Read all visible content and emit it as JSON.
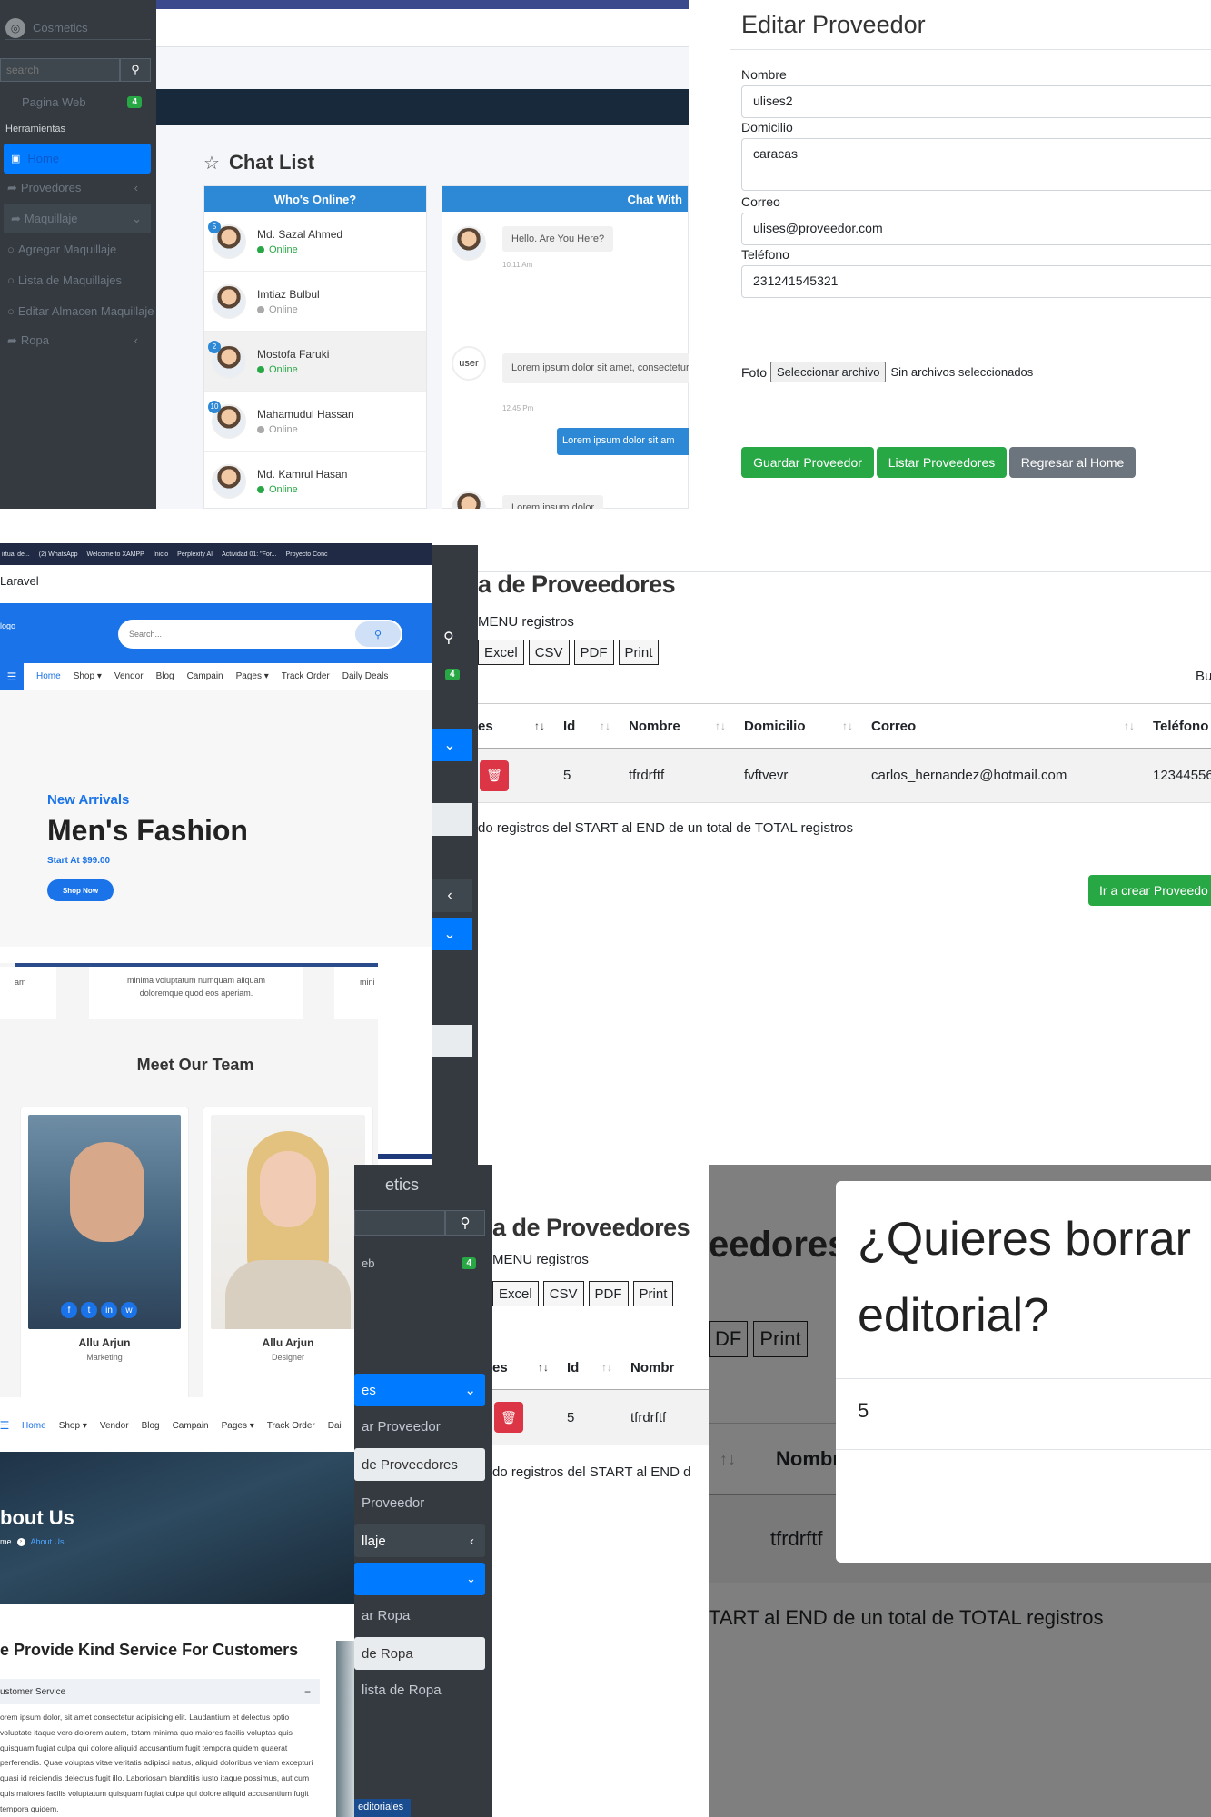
{
  "panel1": {
    "sidebar": {
      "brand": "Cosmetics",
      "search_placeholder": "search",
      "items": [
        {
          "label": "Pagina Web",
          "badge": "4"
        },
        {
          "label": "Herramientas"
        },
        {
          "label": "Home"
        },
        {
          "label": "Provedores"
        },
        {
          "label": "Maquillaje"
        },
        {
          "label": "Agregar Maquillaje"
        },
        {
          "label": "Lista de Maquillajes"
        },
        {
          "label": "Editar Almacen Maquillaje"
        },
        {
          "label": "Ropa"
        }
      ]
    },
    "chat": {
      "title": "Chat List",
      "online_header": "Who's Online?",
      "chat_header": "Chat With",
      "users": [
        {
          "name": "Md. Sazal Ahmed",
          "status": "Online",
          "badge": "5"
        },
        {
          "name": "Imtiaz Bulbul",
          "status": "Online",
          "badge": ""
        },
        {
          "name": "Mostofa Faruki",
          "status": "Online",
          "badge": "2"
        },
        {
          "name": "Mahamudul Hassan",
          "status": "Online",
          "badge": "10"
        },
        {
          "name": "Md. Kamrul Hasan",
          "status": "Online",
          "badge": ""
        }
      ],
      "messages": [
        {
          "text": "Hello. Are You Here?",
          "time": "10.11 Am"
        },
        {
          "text": "Lorem ipsum dolor sit amet, consectetur Lorem ipsum dolor sit.",
          "time": "12.45 Pm",
          "avatar_alt": "user"
        },
        {
          "text": "Lorem ipsum dolor sit am"
        },
        {
          "text": "Lorem ipsum dolor"
        }
      ]
    }
  },
  "panel2": {
    "title": "Editar Proveedor",
    "fields": [
      {
        "label": "Nombre",
        "value": "ulises2"
      },
      {
        "label": "Domicilio",
        "value": "caracas"
      },
      {
        "label": "Correo",
        "value": "ulises@proveedor.com"
      },
      {
        "label": "Teléfono",
        "value": "231241545321"
      }
    ],
    "foto_label": "Foto",
    "file_button": "Seleccionar archivo",
    "file_status": "Sin archivos seleccionados",
    "buttons": {
      "save": "Guardar Proveedor",
      "list": "Listar Proveedores",
      "home": "Regresar al Home"
    }
  },
  "panel3": {
    "bookmarks": [
      "irtual de...",
      "(2) WhatsApp",
      "Welcome to XAMPP",
      "Inicio",
      "Perplexity AI",
      "Actividad 01: \"For...",
      "Proyecto Conc"
    ],
    "tab_title": "Laravel",
    "logo_alt": "logo",
    "search_placeholder": "Search...",
    "nav": [
      "Home",
      "Shop",
      "Vendor",
      "Blog",
      "Campain",
      "Pages",
      "Track Order",
      "Daily Deals"
    ],
    "hero": {
      "kicker": "New Arrivals",
      "title": "Men's Fashion",
      "price": "Start At $99.00",
      "cta": "Shop Now"
    },
    "side_badge": "4",
    "side_label": "s"
  },
  "panel4": {
    "title": "a de Proveedores",
    "menu_text": "MENU registros",
    "export_buttons": [
      "Excel",
      "CSV",
      "PDF",
      "Print"
    ],
    "search_label": "Bu",
    "columns": [
      "es",
      "Id",
      "Nombre",
      "Domicilio",
      "Correo",
      "Teléfono"
    ],
    "row": {
      "id": "5",
      "nombre": "tfrdrftf",
      "domicilio": "fvftvevr",
      "correo": "carlos_hernandez@hotmail.com",
      "telefono": "12344556"
    },
    "info": "do registros del START al END de un total de TOTAL registros",
    "create_button": "Ir a crear Proveedo"
  },
  "panel5": {
    "testimonial_text": "minima voluptatum numquam aliquam doloremque quod eos aperiam.",
    "testimonial_left": "am",
    "testimonial_right": "mini",
    "team_title": "Meet Our Team",
    "members": [
      {
        "name": "Allu Arjun",
        "role": "Marketing"
      },
      {
        "name": "Allu Arjun",
        "role": "Designer"
      }
    ]
  },
  "panel6": {
    "sidebar": {
      "brand": "etics",
      "item_web": "eb",
      "badge": "4",
      "items": [
        "es",
        "ar Proveedor",
        "de Proveedores",
        "Proveedor",
        "llaje",
        "ar Ropa",
        "de Ropa",
        "lista de Ropa",
        "editoriales"
      ]
    },
    "title": "a de Proveedores",
    "menu_text": "MENU registros",
    "export_buttons": [
      "Excel",
      "CSV",
      "PDF",
      "Print"
    ],
    "columns": [
      "es",
      "Id",
      "Nombr"
    ],
    "row": {
      "id": "5",
      "nombre": "tfrdrftf"
    },
    "info": "do registros del START al END d"
  },
  "panel7": {
    "nav": [
      "Home",
      "Shop",
      "Vendor",
      "Blog",
      "Campain",
      "Pages",
      "Track Order",
      "Dai"
    ],
    "hero_title": "bout Us",
    "crumb_home": "me",
    "crumb_current": "About Us",
    "section_title": "e Provide Kind Service For Customers",
    "accordion_title": "ustomer Service",
    "accordion_text": "orem ipsum dolor, sit amet consectetur adipisicing elit. Laudantium et delectus optio voluptate itaque vero dolorem autem, totam minima quo maiores facilis voluptas quis quisquam fugiat culpa qui dolore aliquid accusantium fugit tempora quidem quaerat perferendis. Quae voluptas vitae veritatis adipisci natus, aliquid doloribus veniam excepturi quasi id reiciendis delectus fugit illo. Laboriosam blanditiis iusto itaque possimus, aut cum quis maiores facilis voluptatum quisquam fugiat culpa qui dolore aliquid accusantium fugit tempora quidem."
  },
  "panel8": {
    "bg_title": "eedores",
    "bg_buttons": [
      "DF",
      "Print"
    ],
    "bg_col": "Nombr",
    "bg_cell": "tfrdrftf",
    "bg_info": "TART al END de un total de TOTAL registros",
    "modal_title": "¿Quieres borrar editorial?",
    "modal_body": "5"
  },
  "colors": {
    "primary": "#007bff",
    "success": "#28a745",
    "danger": "#dc3545",
    "sidebar": "#343a40",
    "brand_blue": "#1a73e8"
  }
}
